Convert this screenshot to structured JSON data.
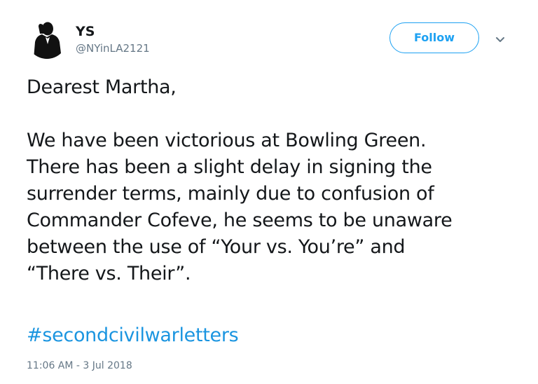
{
  "author": {
    "display_name": "YS",
    "handle": "@NYinLA2121"
  },
  "actions": {
    "follow_label": "Follow"
  },
  "tweet": {
    "text": "Dearest Martha,\n\nWe have been victorious at Bowling Green.\nThere has been a slight delay in signing the\nsurrender terms, mainly due to confusion of\nCommander Cofeve, he seems to be unaware\nbetween the use of “Your vs. You’re” and\n“There vs. Their”.",
    "hashtag": "#secondcivilwarletters",
    "timestamp": "11:06 AM - 3 Jul 2018"
  },
  "colors": {
    "accent": "#1da1f2",
    "hashtag": "#1b95e0",
    "secondary_text": "#657786",
    "primary_text": "#14171a"
  },
  "icons": {
    "avatar": "silhouette-on-phone-avatar",
    "caret": "chevron-down-icon"
  }
}
